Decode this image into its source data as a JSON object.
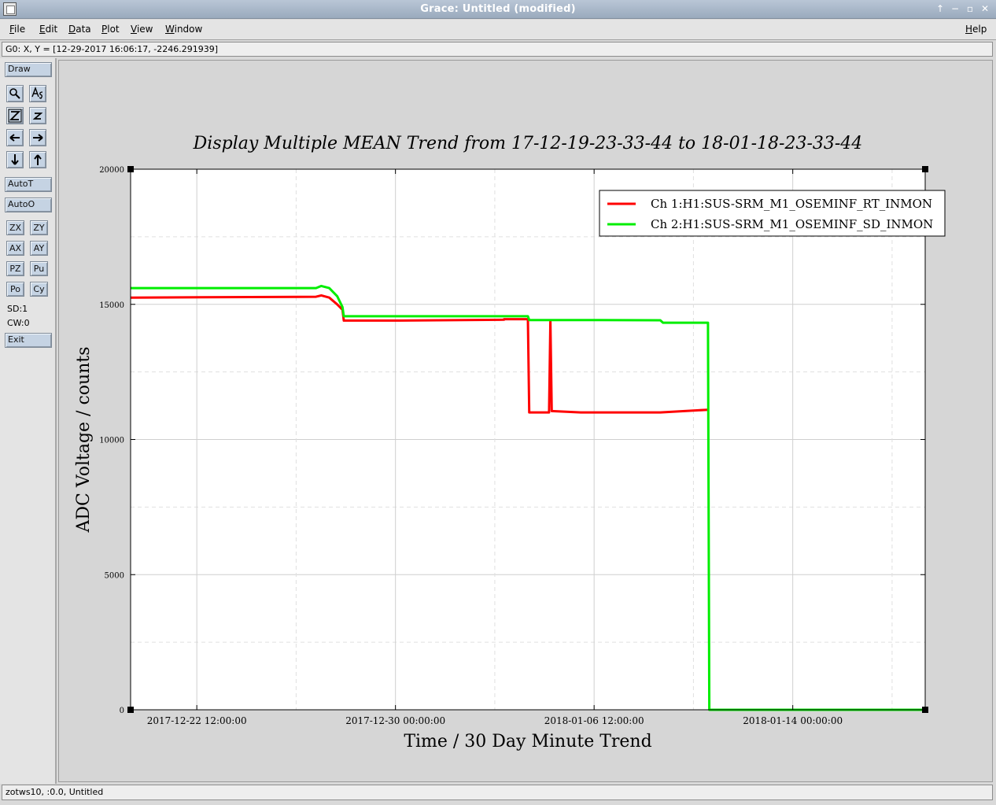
{
  "window": {
    "title": "Grace: Untitled (modified)",
    "controls": [
      "↑",
      "−",
      "▫",
      "✕"
    ]
  },
  "menubar": {
    "items": [
      {
        "label": "File",
        "u": "F",
        "rest": "ile"
      },
      {
        "label": "Edit",
        "u": "E",
        "rest": "dit"
      },
      {
        "label": "Data",
        "u": "D",
        "rest": "ata"
      },
      {
        "label": "Plot",
        "u": "P",
        "rest": "lot"
      },
      {
        "label": "View",
        "u": "V",
        "rest": "iew"
      },
      {
        "label": "Window",
        "u": "W",
        "rest": "indow"
      }
    ],
    "help": {
      "u": "H",
      "rest": "elp"
    }
  },
  "locator": "G0: X, Y = [12-29-2017 16:06:17, -2246.291939]",
  "toolbar": {
    "draw": "Draw",
    "icons": [
      "magnifier-icon",
      "text-label-icon",
      "zoom-z-icon",
      "zoom-z-small-icon",
      "arrow-left-icon",
      "arrow-right-icon",
      "arrow-down-icon",
      "arrow-up-icon"
    ],
    "autot": "AutoT",
    "autoo": "AutoO",
    "zx": "ZX",
    "zy": "ZY",
    "ax": "AX",
    "ay": "AY",
    "pz": "PZ",
    "pu": "Pu",
    "po": "Po",
    "cy": "Cy",
    "sd": "SD:1",
    "cw": "CW:0",
    "exit": "Exit"
  },
  "statusbar": "zotws10, :0.0, Untitled",
  "chart_data": {
    "type": "line",
    "title": "Display Multiple MEAN Trend from 17-12-19-23-33-44 to 18-01-18-23-33-44",
    "xlabel": "Time / 30 Day Minute Trend",
    "ylabel": "ADC Voltage / counts",
    "xlim_days": [
      0,
      30
    ],
    "ylim": [
      0,
      20000
    ],
    "x_unit": "days since 2017-12-19 23:33:44",
    "x_ticks": [
      {
        "day": 2.5,
        "label": "2017-12-22 12:00:00"
      },
      {
        "day": 10.0,
        "label": "2017-12-30 00:00:00"
      },
      {
        "day": 17.5,
        "label": "2018-01-06 12:00:00"
      },
      {
        "day": 25.0,
        "label": "2018-01-14 00:00:00"
      }
    ],
    "y_ticks": [
      0,
      5000,
      10000,
      15000,
      20000
    ],
    "grid": true,
    "legend_position": "top-right",
    "series": [
      {
        "name": "Ch 1:H1:SUS-SRM_M1_OSEMINF_RT_INMON",
        "color": "#ff0000",
        "points": [
          [
            0,
            15250
          ],
          [
            7.0,
            15280
          ],
          [
            7.2,
            15330
          ],
          [
            7.5,
            15250
          ],
          [
            7.8,
            15000
          ],
          [
            8.0,
            14800
          ],
          [
            8.05,
            14400
          ],
          [
            10.0,
            14400
          ],
          [
            14.1,
            14430
          ],
          [
            14.1,
            14450
          ],
          [
            15.0,
            14450
          ],
          [
            15.05,
            11000
          ],
          [
            15.8,
            11000
          ],
          [
            15.85,
            14400
          ],
          [
            15.9,
            11050
          ],
          [
            17.0,
            11000
          ],
          [
            20.0,
            11000
          ],
          [
            21.8,
            11100
          ]
        ]
      },
      {
        "name": "Ch 2:H1:SUS-SRM_M1_OSEMINF_SD_INMON",
        "color": "#00ee00",
        "points": [
          [
            0,
            15600
          ],
          [
            7.0,
            15600
          ],
          [
            7.2,
            15680
          ],
          [
            7.5,
            15600
          ],
          [
            7.8,
            15300
          ],
          [
            8.0,
            14900
          ],
          [
            8.05,
            14560
          ],
          [
            10.0,
            14560
          ],
          [
            15.0,
            14560
          ],
          [
            15.05,
            14420
          ],
          [
            17.0,
            14420
          ],
          [
            20.0,
            14410
          ],
          [
            20.1,
            14320
          ],
          [
            21.8,
            14320
          ],
          [
            21.85,
            0
          ],
          [
            30.0,
            0
          ]
        ]
      }
    ]
  }
}
